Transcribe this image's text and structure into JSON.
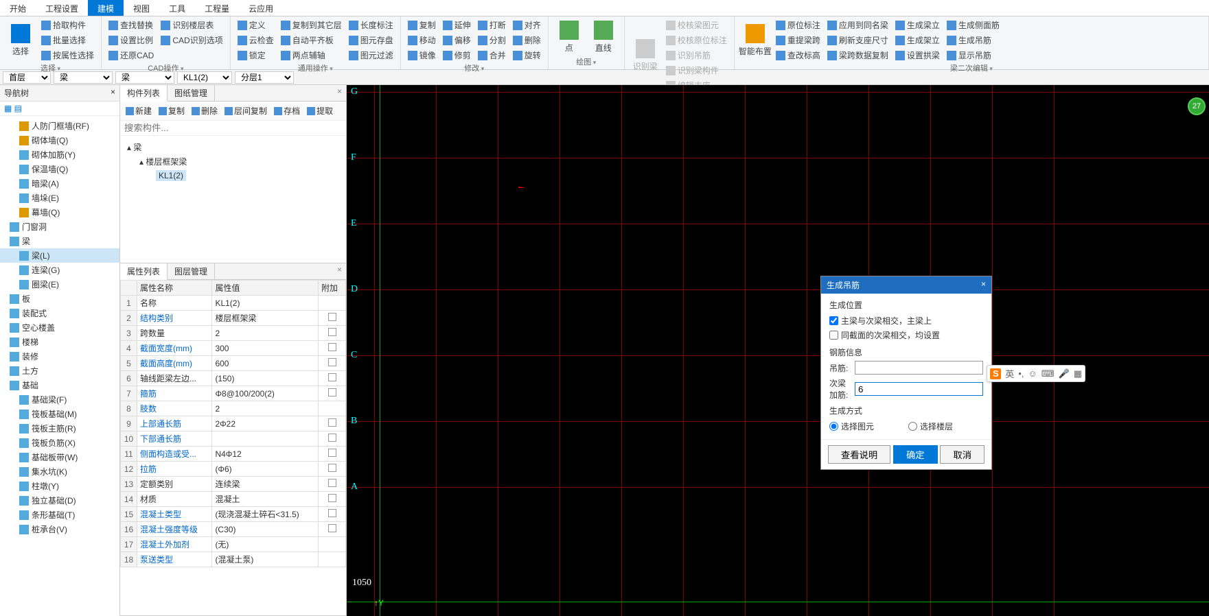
{
  "menu": {
    "items": [
      "开始",
      "工程设置",
      "建模",
      "视图",
      "工具",
      "工程量",
      "云应用"
    ],
    "active": 2
  },
  "ribbon": {
    "g0": {
      "big": "选择",
      "items": [
        "拾取构件",
        "批量选择",
        "按属性选择"
      ],
      "label": "选择"
    },
    "g1": {
      "items": [
        "查找替换",
        "设置比例",
        "还原CAD",
        "识别楼层表",
        "CAD识别选项"
      ],
      "label": "CAD操作"
    },
    "g2": {
      "items": [
        "定义",
        "云检查",
        "锁定",
        "复制到其它层",
        "自动平齐板",
        "两点辅轴",
        "长度标注",
        "图元存盘",
        "图元过滤"
      ],
      "label": "通用操作"
    },
    "g3": {
      "items": [
        "复制",
        "移动",
        "镜像",
        "延伸",
        "偏移",
        "修剪",
        "打断",
        "分割",
        "合并",
        "对齐",
        "删除",
        "旋转"
      ],
      "label": "修改"
    },
    "g4": {
      "items": [
        "点",
        "直线"
      ],
      "label": "绘图"
    },
    "g5": {
      "items": [
        "识别梁",
        "校核梁图元",
        "校核原位标注",
        "识别吊筋",
        "识别梁构件",
        "编辑支座"
      ],
      "label": "识别梁"
    },
    "g6": {
      "items": [
        "智能布置",
        "原位标注",
        "重提梁跨",
        "查改标高",
        "应用到同名梁",
        "刷新支座尺寸",
        "梁跨数据复制",
        "生成梁立",
        "生成架立",
        "设置拱梁",
        "生成侧面筋",
        "生成吊筋",
        "显示吊筋"
      ],
      "label": "梁二次编辑"
    }
  },
  "subbar": {
    "s1": "首层",
    "s2": "梁",
    "s3": "梁",
    "s4": "KL1(2)",
    "s5": "分层1"
  },
  "nav": {
    "title": "导航树",
    "items": [
      {
        "t": "人防门框墙(RF)",
        "i": "#d90"
      },
      {
        "t": "砌体墙(Q)",
        "i": "#d90"
      },
      {
        "t": "砌体加筋(Y)",
        "i": "#5ad"
      },
      {
        "t": "保温墙(Q)",
        "i": "#5ad"
      },
      {
        "t": "暗梁(A)",
        "i": "#5ad"
      },
      {
        "t": "墙垛(E)",
        "i": "#5ad"
      },
      {
        "t": "幕墙(Q)",
        "i": "#d90"
      }
    ],
    "sec1": "门窗洞",
    "sec2": "梁",
    "beams": [
      {
        "t": "梁(L)",
        "sel": true
      },
      {
        "t": "连梁(G)"
      },
      {
        "t": "圈梁(E)"
      }
    ],
    "rest": [
      "板",
      "装配式",
      "空心楼盖",
      "楼梯",
      "装修",
      "土方",
      "基础"
    ],
    "found": [
      {
        "t": "基础梁(F)"
      },
      {
        "t": "筏板基础(M)"
      },
      {
        "t": "筏板主筋(R)"
      },
      {
        "t": "筏板负筋(X)"
      },
      {
        "t": "基础板带(W)"
      },
      {
        "t": "集水坑(K)"
      },
      {
        "t": "柱墩(Y)"
      },
      {
        "t": "独立基础(D)"
      },
      {
        "t": "条形基础(T)"
      },
      {
        "t": "桩承台(V)"
      }
    ]
  },
  "complist": {
    "tabs": [
      "构件列表",
      "图纸管理"
    ],
    "toolbar": [
      "新建",
      "复制",
      "删除",
      "层间复制",
      "存档",
      "提取"
    ],
    "search_ph": "搜索构件...",
    "root": "梁",
    "child": "楼层框架梁",
    "leaf": "KL1(2)"
  },
  "proplist": {
    "tabs": [
      "属性列表",
      "图层管理"
    ],
    "headers": [
      "属性名称",
      "属性值",
      "附加"
    ],
    "rows": [
      {
        "n": "1",
        "k": "名称",
        "v": "KL1(2)"
      },
      {
        "n": "2",
        "k": "结构类别",
        "v": "楼层框架梁",
        "link": true,
        "chk": true
      },
      {
        "n": "3",
        "k": "跨数量",
        "v": "2",
        "chk": true
      },
      {
        "n": "4",
        "k": "截面宽度(mm)",
        "v": "300",
        "link": true,
        "chk": true
      },
      {
        "n": "5",
        "k": "截面高度(mm)",
        "v": "600",
        "link": true,
        "chk": true
      },
      {
        "n": "6",
        "k": "轴线距梁左边...",
        "v": "(150)",
        "chk": true
      },
      {
        "n": "7",
        "k": "箍筋",
        "v": "Φ8@100/200(2)",
        "link": true,
        "chk": true
      },
      {
        "n": "8",
        "k": "肢数",
        "v": "2",
        "link": true
      },
      {
        "n": "9",
        "k": "上部通长筋",
        "v": "2Φ22",
        "link": true,
        "chk": true
      },
      {
        "n": "10",
        "k": "下部通长筋",
        "v": "",
        "link": true,
        "chk": true
      },
      {
        "n": "11",
        "k": "侧面构造或受...",
        "v": "N4Φ12",
        "link": true,
        "chk": true
      },
      {
        "n": "12",
        "k": "拉筋",
        "v": "(Φ6)",
        "link": true,
        "chk": true
      },
      {
        "n": "13",
        "k": "定额类别",
        "v": "连续梁",
        "chk": true
      },
      {
        "n": "14",
        "k": "材质",
        "v": "混凝土",
        "chk": true
      },
      {
        "n": "15",
        "k": "混凝土类型",
        "v": "(现浇混凝土碎石<31.5)",
        "link": true,
        "chk": true
      },
      {
        "n": "16",
        "k": "混凝土强度等级",
        "v": "(C30)",
        "link": true,
        "chk": true
      },
      {
        "n": "17",
        "k": "混凝土外加剂",
        "v": "(无)",
        "link": true
      },
      {
        "n": "18",
        "k": "泵送类型",
        "v": "(混凝土泵)",
        "link": true
      }
    ]
  },
  "canvas": {
    "labels": [
      "G",
      "F",
      "E",
      "D",
      "C",
      "B",
      "A"
    ],
    "num": "1050",
    "badge": "27"
  },
  "dialog": {
    "title": "生成吊筋",
    "sec1": "生成位置",
    "opt1": "主梁与次梁相交，主梁上",
    "opt2": "同截面的次梁相交，均设置",
    "sec2": "钢筋信息",
    "lbl1": "吊筋:",
    "lbl2": "次梁加筋:",
    "val2": "6",
    "sec3": "生成方式",
    "r1": "选择图元",
    "r2": "选择楼层",
    "b1": "查看说明",
    "b2": "确定",
    "b3": "取消"
  },
  "ime": {
    "lang": "英"
  }
}
